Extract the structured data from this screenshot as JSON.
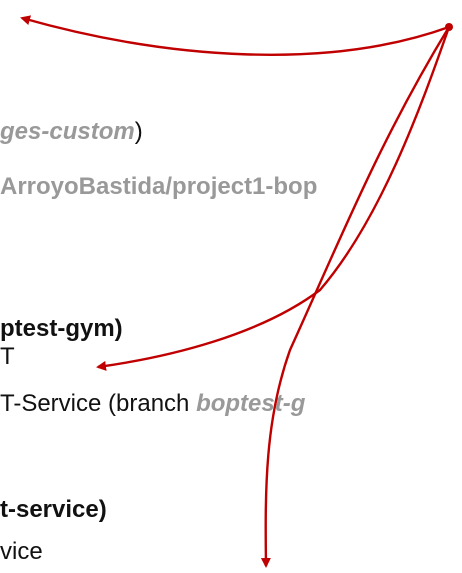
{
  "colors": {
    "arrow": "#c00000",
    "gray_text": "#999999",
    "black_text": "#111111"
  },
  "lines": [
    {
      "a": "ges-custom",
      "b": ")"
    },
    {
      "a": "ArroyoBastida/project1-bop"
    },
    {
      "a": "ptest-gym)"
    },
    {
      "a": "T"
    },
    {
      "a": "T-Service (branch ",
      "b": "boptest-g"
    },
    {
      "a": "t-service)"
    },
    {
      "a": "vice"
    }
  ]
}
